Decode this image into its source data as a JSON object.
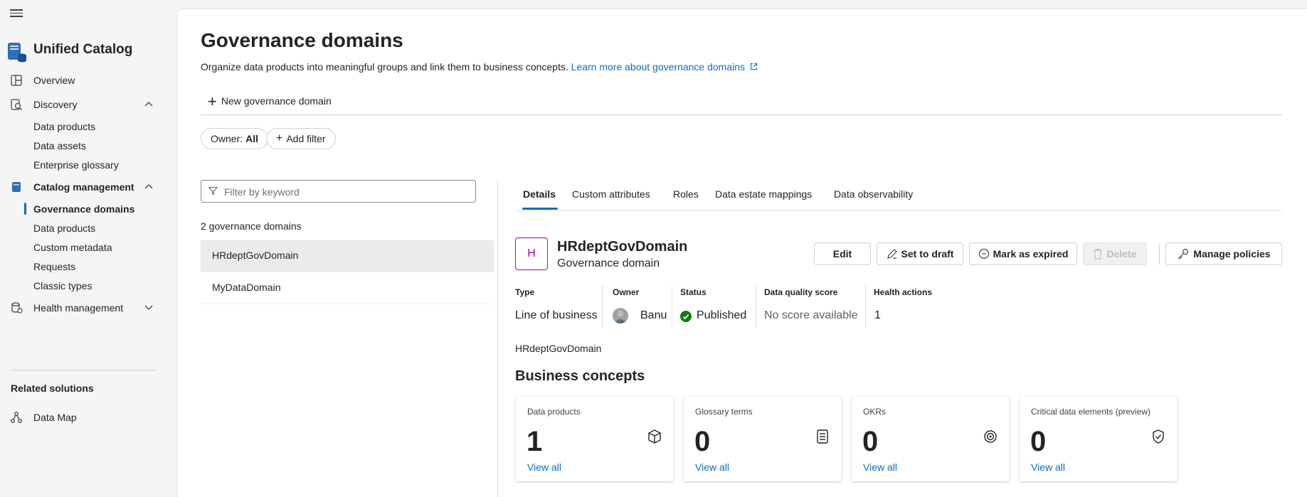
{
  "app": {
    "title": "Unified Catalog"
  },
  "sidebar": {
    "items": [
      {
        "label": "Overview"
      },
      {
        "label": "Discovery"
      },
      {
        "label": "Data products"
      },
      {
        "label": "Data assets"
      },
      {
        "label": "Enterprise glossary"
      },
      {
        "label": "Catalog management"
      },
      {
        "label": "Governance domains"
      },
      {
        "label": "Data products"
      },
      {
        "label": "Custom metadata"
      },
      {
        "label": "Requests"
      },
      {
        "label": "Classic types"
      },
      {
        "label": "Health management"
      }
    ],
    "related_heading": "Related solutions",
    "related_items": [
      {
        "label": "Data Map"
      }
    ]
  },
  "page": {
    "title": "Governance domains",
    "description": "Organize data products into meaningful groups and link them to business concepts.",
    "learn_more": "Learn more about governance domains",
    "new_button": "New governance domain"
  },
  "filters": {
    "owner_label": "Owner:",
    "owner_value": "All",
    "add_filter": "Add filter",
    "keyword_placeholder": "Filter by keyword"
  },
  "list": {
    "count_label": "2 governance domains",
    "items": [
      {
        "name": "HRdeptGovDomain"
      },
      {
        "name": "MyDataDomain"
      }
    ]
  },
  "detail": {
    "tabs": [
      {
        "label": "Details"
      },
      {
        "label": "Custom attributes"
      },
      {
        "label": "Roles"
      },
      {
        "label": "Data estate mappings"
      },
      {
        "label": "Data observability"
      }
    ],
    "avatar_letter": "H",
    "name": "HRdeptGovDomain",
    "subtitle": "Governance domain",
    "actions": {
      "edit": "Edit",
      "set_to_draft": "Set to draft",
      "mark_expired": "Mark as expired",
      "delete": "Delete",
      "manage_policies": "Manage policies"
    },
    "properties": {
      "type_label": "Type",
      "type_value": "Line of business",
      "owner_label": "Owner",
      "owner_value": "Banu",
      "status_label": "Status",
      "status_value": "Published",
      "dq_label": "Data quality score",
      "dq_value": "No score available",
      "health_label": "Health actions",
      "health_value": "1"
    },
    "path": "HRdeptGovDomain",
    "business_concepts": {
      "title": "Business concepts",
      "cards": [
        {
          "title": "Data products",
          "count": "1",
          "link": "View all"
        },
        {
          "title": "Glossary terms",
          "count": "0",
          "link": "View all"
        },
        {
          "title": "OKRs",
          "count": "0",
          "link": "View all"
        },
        {
          "title": "Critical data elements (preview)",
          "count": "0",
          "link": "View all"
        }
      ]
    }
  },
  "colors": {
    "accent": "#0f6cbd",
    "domain_avatar": "#b4009e",
    "published": "#107c10"
  }
}
